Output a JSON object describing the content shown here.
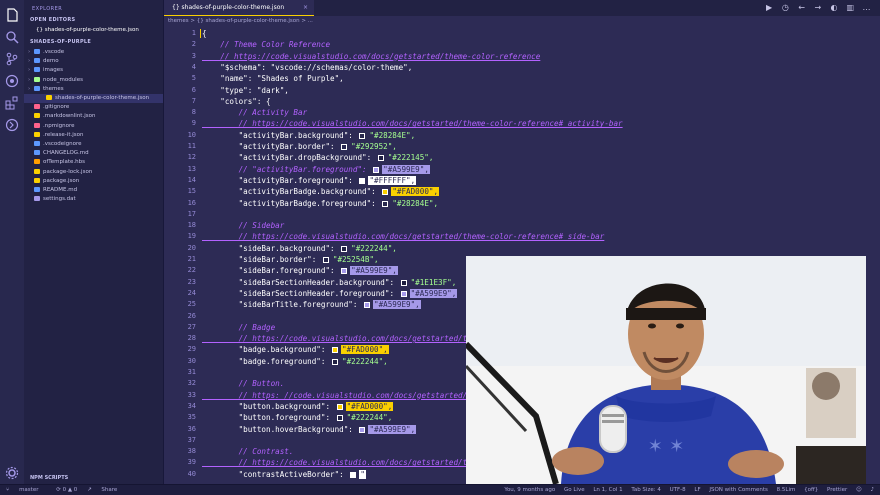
{
  "activity_icons": [
    "files-icon",
    "search-icon",
    "source-control-icon",
    "debug-icon",
    "extensions-icon",
    "remote-icon",
    "gear-icon"
  ],
  "sidebar": {
    "title": "EXPLORER",
    "open_editors_label": "OPEN EDITORS",
    "open_editor_file": "{} shades-of-purple-color-theme.json",
    "project_label": "SHADES-OF-PURPLE",
    "items": [
      {
        "label": ".vscode",
        "type": "folder",
        "color": "#5d98ff"
      },
      {
        "label": "demo",
        "type": "folder",
        "color": "#5d98ff"
      },
      {
        "label": "images",
        "type": "folder",
        "color": "#5d98ff"
      },
      {
        "label": "node_modules",
        "type": "folder",
        "color": "#a5ff90"
      },
      {
        "label": "themes",
        "type": "folder",
        "color": "#5d98ff"
      },
      {
        "label": "shades-of-purple-color-theme.json",
        "type": "file",
        "color": "#fad000"
      },
      {
        "label": ".gitignore",
        "type": "file",
        "color": "#ff628c"
      },
      {
        "label": ".markdownlint.json",
        "type": "file",
        "color": "#fad000"
      },
      {
        "label": ".npmignore",
        "type": "file",
        "color": "#ff628c"
      },
      {
        "label": ".release-it.json",
        "type": "file",
        "color": "#fad000"
      },
      {
        "label": ".vscodeignore",
        "type": "file",
        "color": "#5d98ff"
      },
      {
        "label": "CHANGELOG.md",
        "type": "file",
        "color": "#5d98ff"
      },
      {
        "label": "ofTemplate.hbs",
        "type": "file",
        "color": "#ff9d00"
      },
      {
        "label": "package-lock.json",
        "type": "file",
        "color": "#fad000"
      },
      {
        "label": "package.json",
        "type": "file",
        "color": "#fad000"
      },
      {
        "label": "README.md",
        "type": "file",
        "color": "#5d98ff"
      },
      {
        "label": "settings.dat",
        "type": "file",
        "color": "#a599e9"
      }
    ],
    "npm_scripts_label": "NPM SCRIPTS"
  },
  "tab": {
    "label": "{} shades-of-purple-color-theme.json"
  },
  "breadcrumb": "themes > {} shades-of-purple-color-theme.json > ...",
  "editor_lines": [
    {
      "n": "1",
      "text": "{"
    },
    {
      "n": "2",
      "text": "    // Theme Color Reference"
    },
    {
      "n": "3",
      "text": "    // https://code.visualstudio.com/docs/getstarted/theme-color-reference"
    },
    {
      "n": "4",
      "text": "    \"$schema\": \"vscode://schemas/color-theme\","
    },
    {
      "n": "5",
      "text": "    \"name\": \"Shades of Purple\","
    },
    {
      "n": "6",
      "text": "    \"type\": \"dark\","
    },
    {
      "n": "7",
      "text": "    \"colors\": {"
    },
    {
      "n": "8",
      "text": "        // Activity Bar"
    },
    {
      "n": "9",
      "text": "        // https://code.visualstudio.com/docs/getstarted/theme-color-reference#_activity-bar"
    },
    {
      "n": "10",
      "text": "        \"activityBar.background\": ",
      "value": "\"#28284E\","
    },
    {
      "n": "11",
      "text": "        \"activityBar.border\": ",
      "value": "\"#292952\","
    },
    {
      "n": "12",
      "text": "        \"activityBar.dropBackground\": ",
      "value": "\"#222145\","
    },
    {
      "n": "13",
      "text": "        // \"activityBar.foreground\": ",
      "value": "\"#A599E9\","
    },
    {
      "n": "14",
      "text": "        \"activityBar.foreground\": ",
      "value": "\"#FFFFFF\","
    },
    {
      "n": "15",
      "text": "        \"activityBarBadge.background\": ",
      "value": "\"#FAD000\","
    },
    {
      "n": "16",
      "text": "        \"activityBarBadge.foreground\": ",
      "value": "\"#28284E\","
    },
    {
      "n": "17",
      "text": ""
    },
    {
      "n": "18",
      "text": "        // Sidebar"
    },
    {
      "n": "19",
      "text": "        // https://code.visualstudio.com/docs/getstarted/theme-color-reference#_side-bar"
    },
    {
      "n": "20",
      "text": "        \"sideBar.background\": ",
      "value": "\"#222244\","
    },
    {
      "n": "21",
      "text": "        \"sideBar.border\": ",
      "value": "\"#25254B\","
    },
    {
      "n": "22",
      "text": "        \"sideBar.foreground\": ",
      "value": "\"#A599E9\","
    },
    {
      "n": "23",
      "text": "        \"sideBarSectionHeader.background\": ",
      "value": "\"#1E1E3F\","
    },
    {
      "n": "24",
      "text": "        \"sideBarSectionHeader.foreground\": ",
      "value": "\"#A599E9\","
    },
    {
      "n": "25",
      "text": "        \"sideBarTitle.foreground\": ",
      "value": "\"#A599E9\","
    },
    {
      "n": "26",
      "text": ""
    },
    {
      "n": "27",
      "text": "        // Badge"
    },
    {
      "n": "28",
      "text": "        // https://code.visualstudio.com/docs/getstarted/t"
    },
    {
      "n": "29",
      "text": "        \"badge.background\": ",
      "value": "\"#FAD000\","
    },
    {
      "n": "30",
      "text": "        \"badge.foreground\": ",
      "value": "\"#222244\","
    },
    {
      "n": "31",
      "text": ""
    },
    {
      "n": "32",
      "text": "        // Button."
    },
    {
      "n": "33",
      "text": "        // https: //code.visualstudio.com/docs/getstarted/"
    },
    {
      "n": "34",
      "text": "        \"button.background\": ",
      "value": "\"#FAD000\","
    },
    {
      "n": "35",
      "text": "        \"button.foreground\": ",
      "value": "\"#222244\","
    },
    {
      "n": "36",
      "text": "        \"button.hoverBackground\": ",
      "value": "\"#A599E9\","
    },
    {
      "n": "37",
      "text": ""
    },
    {
      "n": "38",
      "text": "        // Contrast."
    },
    {
      "n": "39",
      "text": "        // https://code.visualstudio.com/docs/getstarted/t"
    },
    {
      "n": "40",
      "text": "        \"contrastActiveBorder\": ",
      "value": "\""
    }
  ],
  "swatches": {
    "10": "#28284e",
    "11": "#292952",
    "12": "#222145",
    "13": "#a599e9",
    "14": "#ffffff",
    "15": "#fad000",
    "16": "#28284e",
    "20": "#222244",
    "21": "#25254b",
    "22": "#a599e9",
    "23": "#1e1e3f",
    "24": "#a599e9",
    "25": "#a599e9",
    "29": "#fad000",
    "30": "#222244",
    "34": "#fad000",
    "35": "#222244",
    "36": "#a599e9",
    "40": "#ffffff"
  },
  "statusbar": {
    "branch": "master",
    "sync": "⟳ 0 ▲ 0",
    "share": "Share",
    "blame": "You, 9 months ago",
    "go_live": "Go Live",
    "position": "Ln 1, Col 1",
    "tab_size": "Tab Size: 4",
    "encoding": "UTF-8",
    "eol": "LF",
    "language": "JSON with Comments",
    "size": "8.5Lim",
    "prettier_ext": "{off}",
    "prettier": "Prettier"
  },
  "colors": {
    "activity_bar": "#28284e",
    "sidebar": "#222244",
    "editor": "#2d2b55",
    "accent": "#fad000",
    "comment": "#b362ff",
    "string": "#a5ff90"
  }
}
